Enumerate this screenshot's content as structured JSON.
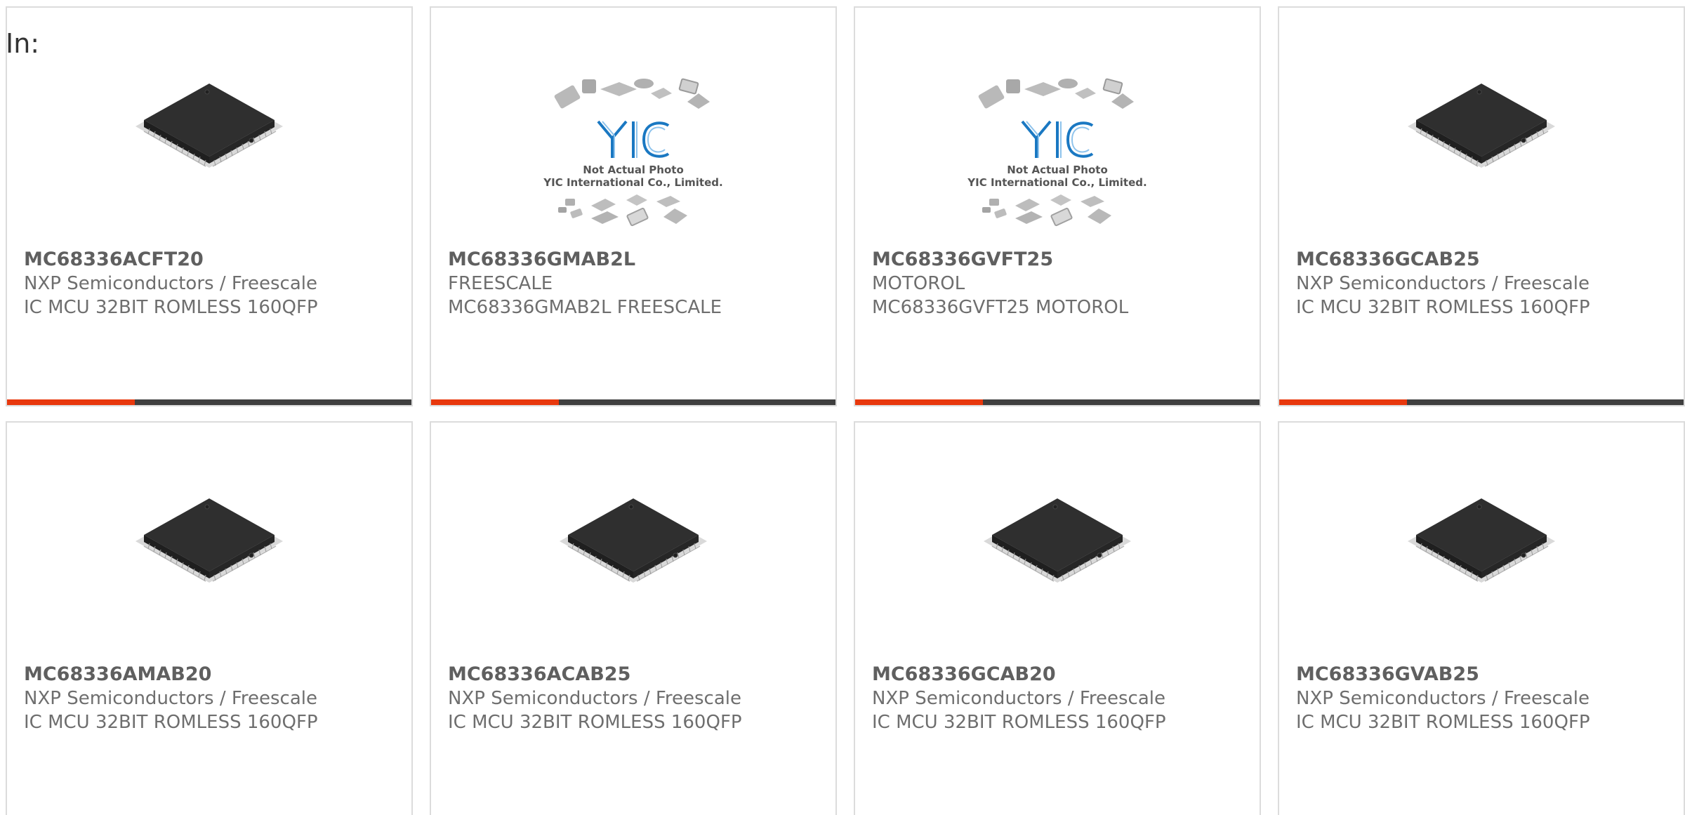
{
  "header": {
    "label": "In:"
  },
  "colors": {
    "accent": "#e8380d",
    "bar": "#3f3f3f",
    "border": "#dcdcdc"
  },
  "cards": [
    {
      "part": "MC68336ACFT20",
      "mfr": "NXP Semiconductors / Freescale",
      "desc": "IC MCU 32BIT ROMLESS 160QFP",
      "image": "chip-image",
      "bar": true
    },
    {
      "part": "MC68336GMAB2L",
      "mfr": "FREESCALE",
      "desc": "MC68336GMAB2L FREESCALE",
      "image": "placeholder-image",
      "bar": true,
      "placeholder": {
        "logo": "YIC",
        "line1": "Not Actual Photo",
        "line2": "YIC International Co., Limited."
      }
    },
    {
      "part": "MC68336GVFT25",
      "mfr": "MOTOROL",
      "desc": "MC68336GVFT25 MOTOROL",
      "image": "placeholder-image",
      "bar": true,
      "placeholder": {
        "logo": "YIC",
        "line1": "Not Actual Photo",
        "line2": "YIC International Co., Limited."
      }
    },
    {
      "part": "MC68336GCAB25",
      "mfr": "NXP Semiconductors / Freescale",
      "desc": "IC MCU 32BIT ROMLESS 160QFP",
      "image": "chip-image",
      "bar": true
    },
    {
      "part": "MC68336AMAB20",
      "mfr": "NXP Semiconductors / Freescale",
      "desc": "IC MCU 32BIT ROMLESS 160QFP",
      "image": "chip-image",
      "bar": false
    },
    {
      "part": "MC68336ACAB25",
      "mfr": "NXP Semiconductors / Freescale",
      "desc": "IC MCU 32BIT ROMLESS 160QFP",
      "image": "chip-image",
      "bar": false
    },
    {
      "part": "MC68336GCAB20",
      "mfr": "NXP Semiconductors / Freescale",
      "desc": "IC MCU 32BIT ROMLESS 160QFP",
      "image": "chip-image",
      "bar": false
    },
    {
      "part": "MC68336GVAB25",
      "mfr": "NXP Semiconductors / Freescale",
      "desc": "IC MCU 32BIT ROMLESS 160QFP",
      "image": "chip-image",
      "bar": false
    }
  ]
}
